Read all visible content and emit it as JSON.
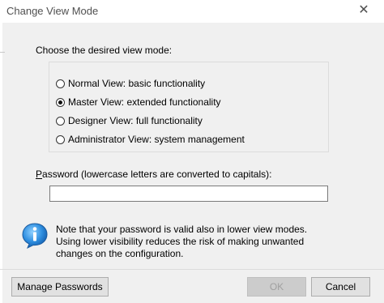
{
  "window": {
    "title": "Change View Mode"
  },
  "prompt": "Choose the desired view mode:",
  "view_modes": [
    {
      "label": "Normal View:  basic functionality",
      "checked": false
    },
    {
      "label": "Master View:  extended functionality",
      "checked": true
    },
    {
      "label": "Designer View:  full functionality",
      "checked": false
    },
    {
      "label": "Administrator View:  system management",
      "checked": false
    }
  ],
  "password": {
    "label_first": "P",
    "label_rest": "assword (lowercase letters are converted to capitals):",
    "value": ""
  },
  "note": {
    "line1": "Note that your password is valid also in lower view modes.",
    "line2": "Using lower visibility reduces the risk of making unwanted",
    "line3": "changes on the configuration."
  },
  "buttons": {
    "manage": "Manage Passwords",
    "ok": "OK",
    "cancel": "Cancel"
  }
}
